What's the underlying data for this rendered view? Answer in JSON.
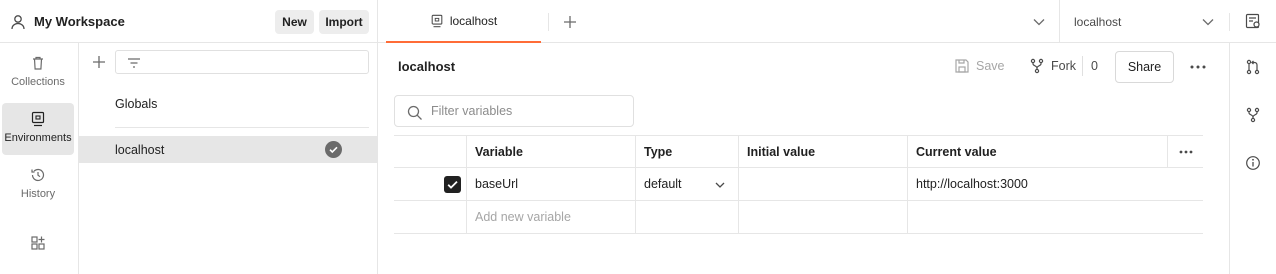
{
  "workspace": {
    "name": "My Workspace",
    "new_label": "New",
    "import_label": "Import"
  },
  "rail": {
    "items": [
      {
        "label": "Collections",
        "icon": "trash-can-icon"
      },
      {
        "label": "Environments",
        "icon": "environment-icon"
      },
      {
        "label": "History",
        "icon": "history-icon"
      },
      {
        "label": "",
        "icon": "apps-grid-icon"
      }
    ]
  },
  "environments": {
    "items": [
      {
        "label": "Globals"
      },
      {
        "label": "localhost",
        "active": true
      }
    ]
  },
  "tabs": {
    "items": [
      {
        "label": "localhost"
      }
    ],
    "env_selector": "localhost"
  },
  "main": {
    "title": "localhost",
    "save_label": "Save",
    "fork_label": "Fork",
    "fork_count": "0",
    "share_label": "Share",
    "search_placeholder": "Filter variables"
  },
  "table": {
    "headers": {
      "variable": "Variable",
      "type": "Type",
      "initial": "Initial value",
      "current": "Current value"
    },
    "rows": [
      {
        "checked": true,
        "variable": "baseUrl",
        "type": "default",
        "initial": "",
        "current": "http://localhost:3000"
      }
    ],
    "new_row_placeholder": "Add new variable"
  },
  "colors": {
    "accent": "#ff6c37",
    "active_bg": "#e6e6e6",
    "border": "#e6e6e6"
  }
}
